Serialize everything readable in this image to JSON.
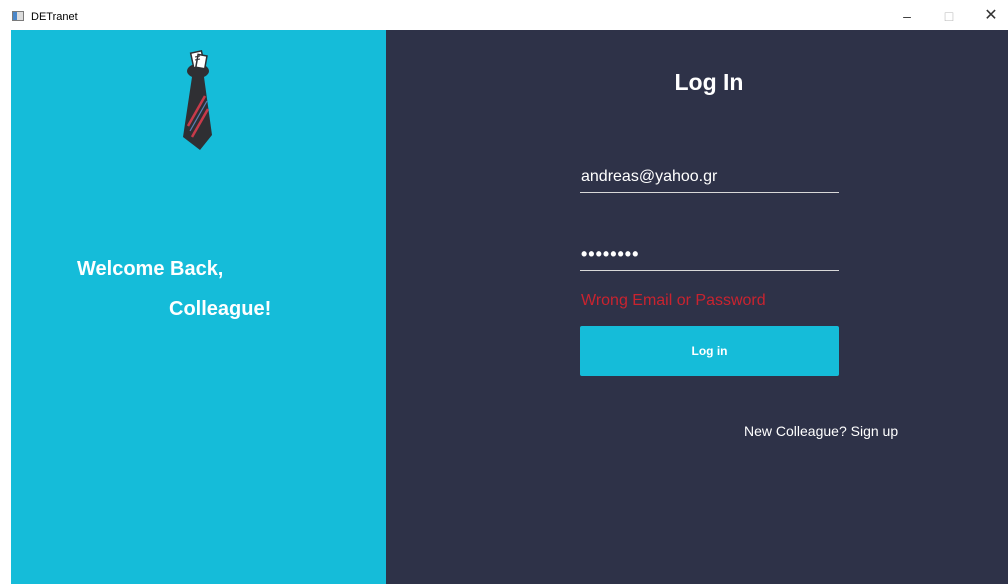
{
  "window": {
    "title": "DETranet",
    "app_icon": "app-window-icon",
    "controls": {
      "minimize": "–",
      "maximize": "□",
      "close": "✕"
    }
  },
  "left_panel": {
    "logo_icon": "tie-logo-icon",
    "welcome_line1": "Welcome Back,",
    "welcome_line2": "Colleague!"
  },
  "login": {
    "title": "Log In",
    "email_value": "andreas@yahoo.gr",
    "password_value": "12345678",
    "error_message": "Wrong Email or Password",
    "button_label": "Log in",
    "signup_text": "New Colleague? Sign up"
  },
  "colors": {
    "left_panel_bg": "#15bcd9",
    "right_panel_bg": "#2e3248",
    "button_bg": "#15bcd9",
    "error": "#c9232f",
    "text": "#ffffff"
  }
}
